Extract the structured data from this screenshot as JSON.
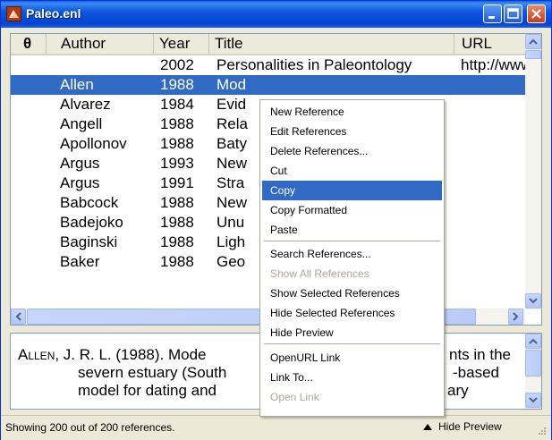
{
  "window": {
    "title": "Paleo.enl"
  },
  "columns": {
    "attach": "θ",
    "author": "Author",
    "year": "Year",
    "title": "Title",
    "url": "URL"
  },
  "rows": [
    {
      "author": "",
      "year": "2002",
      "title": "Personalities in Paleontology",
      "url": "http://www"
    },
    {
      "author": "Allen",
      "year": "1988",
      "title": "Mod",
      "url": ""
    },
    {
      "author": "Alvarez",
      "year": "1984",
      "title": "Evid",
      "url": ""
    },
    {
      "author": "Angell",
      "year": "1988",
      "title": "Rela",
      "url": ""
    },
    {
      "author": "Apollonov",
      "year": "1988",
      "title": "Baty",
      "url": ""
    },
    {
      "author": "Argus",
      "year": "1993",
      "title": "New",
      "url": ""
    },
    {
      "author": "Argus",
      "year": "1991",
      "title": "Stra",
      "url": ""
    },
    {
      "author": "Babcock",
      "year": "1988",
      "title": "New",
      "url": ""
    },
    {
      "author": "Badejoko",
      "year": "1988",
      "title": "Unu",
      "url": ""
    },
    {
      "author": "Baginski",
      "year": "1988",
      "title": "Ligh",
      "url": ""
    },
    {
      "author": "Baker",
      "year": "1988",
      "title": "Geo",
      "url": ""
    }
  ],
  "selected_row": 1,
  "preview": {
    "author": "Allen",
    "line1_rest": ", J. R. L. (1988). Mode",
    "line1_right": "nts in the",
    "line2_left": "severn estuary (South",
    "line2_right": "-based",
    "line3_left": "model for dating and",
    "line3_right": "ary"
  },
  "status": {
    "text": "Showing 200 out of 200 references.",
    "hide_preview": "Hide Preview"
  },
  "context_menu": {
    "items": [
      {
        "label": "New Reference",
        "state": "normal"
      },
      {
        "label": "Edit References",
        "state": "normal"
      },
      {
        "label": "Delete References...",
        "state": "normal"
      },
      {
        "label": "Cut",
        "state": "normal"
      },
      {
        "label": "Copy",
        "state": "highlighted"
      },
      {
        "label": "Copy Formatted",
        "state": "normal"
      },
      {
        "label": "Paste",
        "state": "normal"
      },
      {
        "label": "Search References...",
        "state": "normal"
      },
      {
        "label": "Show All References",
        "state": "disabled"
      },
      {
        "label": "Show Selected References",
        "state": "normal"
      },
      {
        "label": "Hide Selected References",
        "state": "normal"
      },
      {
        "label": "Hide Preview",
        "state": "normal"
      },
      {
        "label": "OpenURL Link",
        "state": "normal"
      },
      {
        "label": "Link To...",
        "state": "normal"
      },
      {
        "label": "Open Link",
        "state": "disabled"
      }
    ]
  },
  "colors": {
    "selection": "#316ac5",
    "titlebar": "#0244d3",
    "disabled": "#aca899"
  }
}
